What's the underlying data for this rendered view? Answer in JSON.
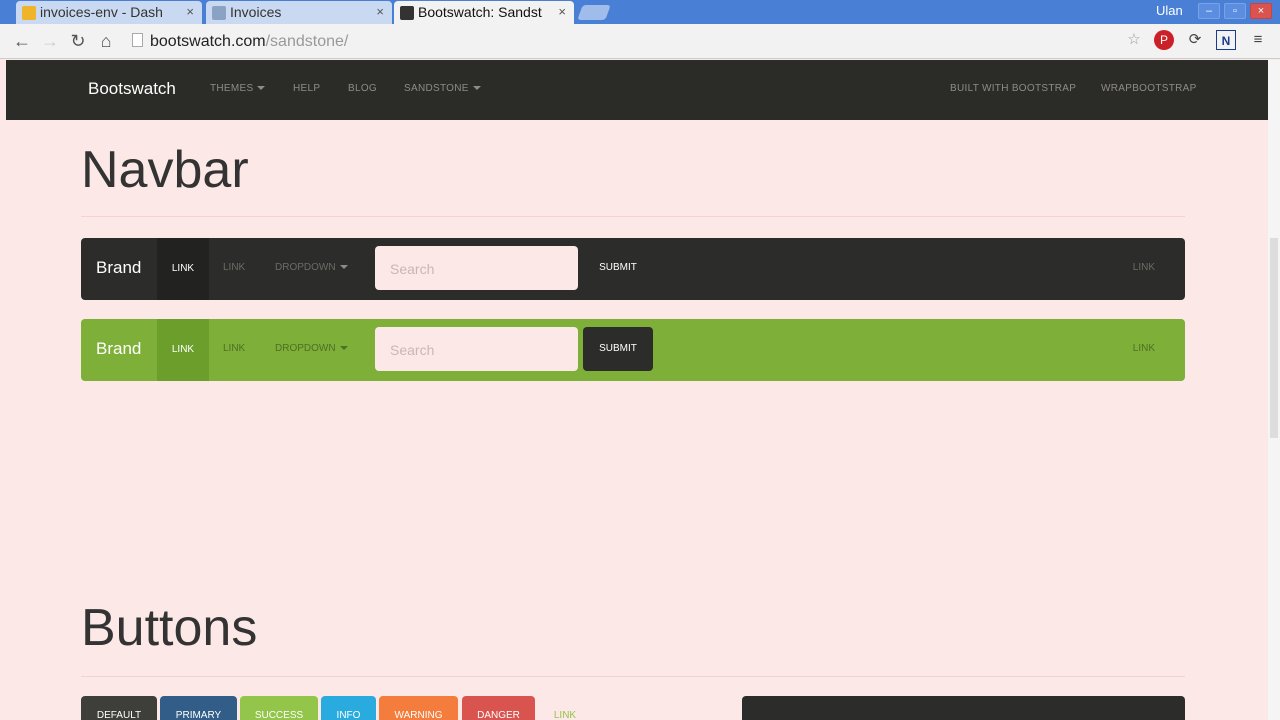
{
  "browser": {
    "tabs": [
      {
        "label": "invoices-env - Dash",
        "active": false
      },
      {
        "label": "Invoices",
        "active": false
      },
      {
        "label": "Bootswatch: Sandst",
        "active": true
      }
    ],
    "user": "Ulan",
    "url_host": "bootswatch.com",
    "url_path": "/sandstone/"
  },
  "site_nav": {
    "brand": "Bootswatch",
    "themes": "THEMES",
    "help": "HELP",
    "blog": "BLOG",
    "sandstone": "SANDSTONE",
    "built": "BUILT WITH BOOTSTRAP",
    "wrap": "WRAPBOOTSTRAP"
  },
  "navbar_section": {
    "title": "Navbar",
    "brand": "Brand",
    "link_active": "LINK",
    "link": "LINK",
    "dropdown": "DROPDOWN",
    "search_placeholder": "Search",
    "submit": "SUBMIT",
    "link_right": "LINK"
  },
  "buttons_section": {
    "title": "Buttons",
    "buttons": [
      "DEFAULT",
      "PRIMARY",
      "SUCCESS",
      "INFO",
      "WARNING",
      "DANGER",
      "LINK"
    ]
  },
  "colors": {
    "default": "#3e3f3a",
    "primary": "#325d88",
    "success": "#93c54b",
    "info": "#29abe0",
    "warning": "#f47c3c",
    "danger": "#d9534f",
    "link": "#93c54b"
  }
}
